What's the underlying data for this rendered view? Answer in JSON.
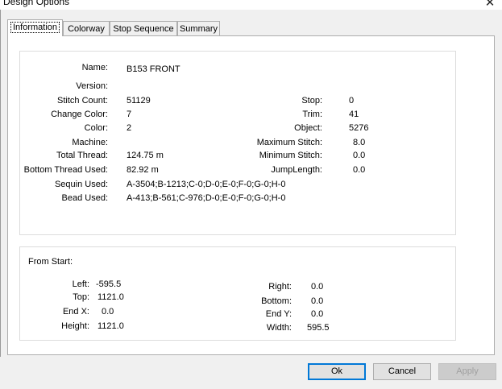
{
  "window": {
    "title": "Design Options",
    "close_icon": "close-icon"
  },
  "tabs": [
    {
      "label": "Information",
      "active": true
    },
    {
      "label": "Colorway",
      "active": false
    },
    {
      "label": "Stop Sequence",
      "active": false
    },
    {
      "label": "Summary",
      "active": false
    }
  ],
  "info": {
    "name": {
      "label": "Name:",
      "value": "B153 FRONT"
    },
    "version": {
      "label": "Version:",
      "value": ""
    },
    "stitch_count": {
      "label": "Stitch Count:",
      "value": "51129"
    },
    "change_color": {
      "label": "Change Color:",
      "value": "7"
    },
    "color": {
      "label": "Color:",
      "value": "2"
    },
    "machine": {
      "label": "Machine:",
      "value": ""
    },
    "total_thread": {
      "label": "Total Thread:",
      "value": "124.75 m"
    },
    "bottom_thread": {
      "label": "Bottom Thread Used:",
      "value": "82.92 m"
    },
    "sequin_used": {
      "label": "Sequin Used:",
      "value": "A-3504;B-1213;C-0;D-0;E-0;F-0;G-0;H-0"
    },
    "bead_used": {
      "label": "Bead Used:",
      "value": "A-413;B-561;C-976;D-0;E-0;F-0;G-0;H-0"
    },
    "stop": {
      "label": "Stop:",
      "value": "0"
    },
    "trim": {
      "label": "Trim:",
      "value": "41"
    },
    "object": {
      "label": "Object:",
      "value": "5276"
    },
    "max_stitch": {
      "label": "Maximum Stitch:",
      "value": "8.0"
    },
    "min_stitch": {
      "label": "Minimum Stitch:",
      "value": "0.0"
    },
    "jump_length": {
      "label": "JumpLength:",
      "value": "0.0"
    }
  },
  "from_start": {
    "heading": "From Start:",
    "left": {
      "label": "Left:",
      "value": "-595.5"
    },
    "top": {
      "label": "Top:",
      "value": "1121.0"
    },
    "end_x": {
      "label": "End X:",
      "value": "0.0"
    },
    "height": {
      "label": "Height:",
      "value": "1121.0"
    },
    "right": {
      "label": "Right:",
      "value": "0.0"
    },
    "bottom": {
      "label": "Bottom:",
      "value": "0.0"
    },
    "end_y": {
      "label": "End Y:",
      "value": "0.0"
    },
    "width": {
      "label": "Width:",
      "value": "595.5"
    }
  },
  "buttons": {
    "ok": "Ok",
    "cancel": "Cancel",
    "apply": "Apply"
  },
  "colors": {
    "accent": "#0078d7",
    "panel_bg": "#ffffff",
    "dialog_bg": "#f0f0f0"
  }
}
